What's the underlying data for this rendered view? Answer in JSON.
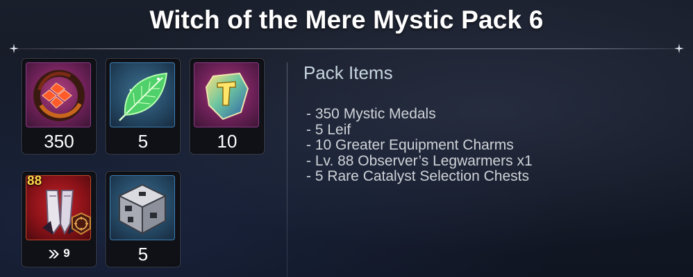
{
  "title": "Witch of the Mere Mystic Pack 6",
  "colors": {
    "accent_gold": "#ffd74a",
    "rarity_purple": "#8c3a86",
    "rarity_blue": "#3d7fb2",
    "rarity_red": "#c44a2a"
  },
  "slots": [
    {
      "icon": "mystic-medal-icon",
      "rarity": "purple",
      "quantity": "350"
    },
    {
      "icon": "leif-leaf-icon",
      "rarity": "blue",
      "quantity": "5"
    },
    {
      "icon": "equipment-charm-icon",
      "rarity": "purple",
      "quantity": "10"
    },
    {
      "icon": "legwarmers-icon",
      "rarity": "red",
      "level": "88",
      "enhance": "9",
      "badge_icon": "class-emblem-icon"
    },
    {
      "icon": "catalyst-chest-icon",
      "rarity": "blue",
      "quantity": "5"
    }
  ],
  "pack_items": {
    "heading": "Pack Items",
    "lines": [
      "- 350 Mystic Medals",
      "- 5 Leif",
      "- 10 Greater Equipment Charms",
      "- Lv. 88 Observer’s Legwarmers x1",
      "- 5 Rare Catalyst Selection Chests"
    ]
  }
}
